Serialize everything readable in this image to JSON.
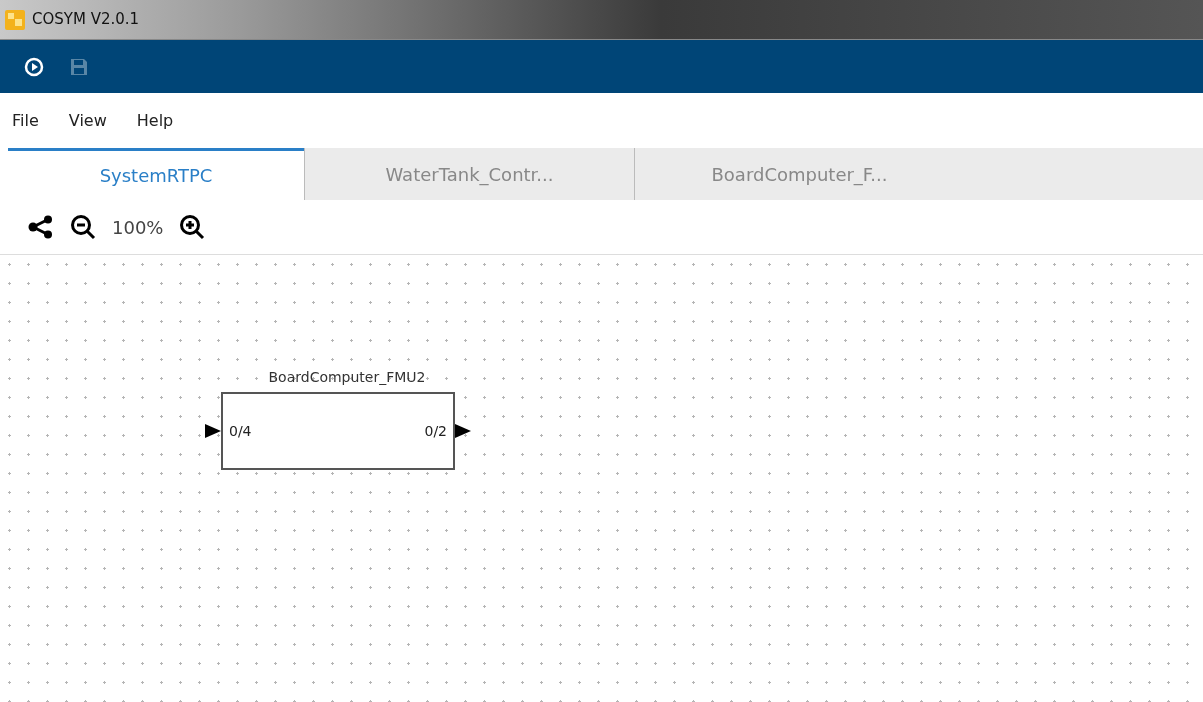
{
  "window": {
    "title": "COSYM V2.0.1"
  },
  "toolbar": {
    "save_disabled": true
  },
  "menu": [
    "File",
    "View",
    "Help"
  ],
  "tabs": [
    {
      "label": "SystemRTPC",
      "selected": true
    },
    {
      "label": "WaterTank_Contr...",
      "selected": false
    },
    {
      "label": "BoardComputer_F...",
      "selected": false
    }
  ],
  "zoom": {
    "value": "100%"
  },
  "canvas": {
    "nodes": [
      {
        "name": "BoardComputer_FMU2",
        "inputs": "0/4",
        "outputs": "0/2"
      }
    ]
  }
}
